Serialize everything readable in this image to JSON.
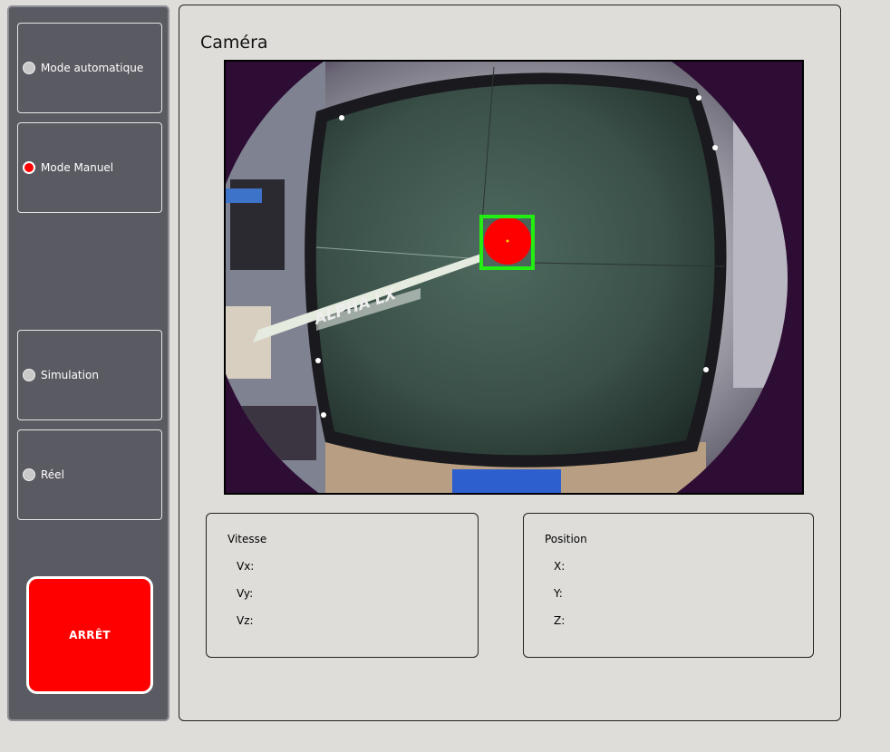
{
  "sidebar": {
    "mode_auto_label": "Mode automatique",
    "mode_manual_label": "Mode Manuel",
    "simulation_label": "Simulation",
    "real_label": "Réel",
    "selected_mode": "Mode Manuel",
    "stop_label": "ARRÊT"
  },
  "camera": {
    "title": "Caméra",
    "overlay_text": "ALPHA LX"
  },
  "speed": {
    "title": "Vitesse",
    "vx_label": "Vx:",
    "vy_label": "Vy:",
    "vz_label": "Vz:"
  },
  "position": {
    "title": "Position",
    "x_label": "X:",
    "y_label": "Y:",
    "z_label": "Z:"
  },
  "colors": {
    "stop": "#ff0000",
    "detection_box": "#22ee11",
    "target": "#ff0000",
    "panel": "#5a5a62"
  }
}
